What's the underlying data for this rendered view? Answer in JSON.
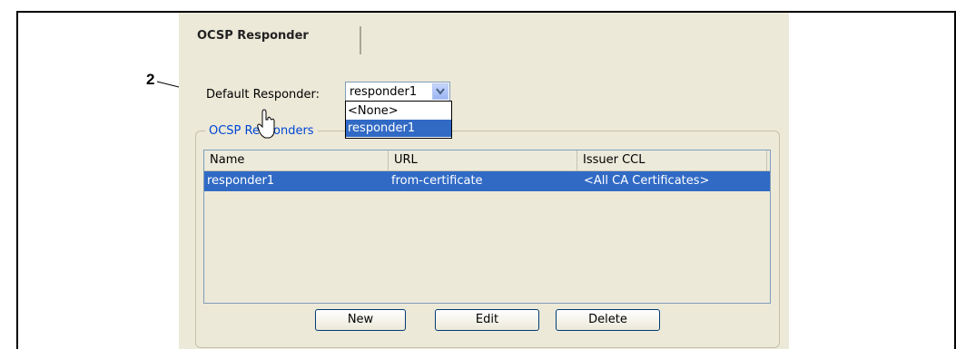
{
  "callout": {
    "number": "2"
  },
  "tab": {
    "label": "OCSP Responder"
  },
  "default_responder": {
    "label": "Default Responder:",
    "selected": "responder1",
    "options": [
      "<None>",
      "responder1"
    ]
  },
  "group": {
    "title": "OCSP Responders"
  },
  "table": {
    "columns": [
      "Name",
      "URL",
      "Issuer CCL"
    ],
    "rows": [
      {
        "name": "responder1",
        "url": "from-certificate",
        "issuer_ccl": "<All CA Certificates>"
      }
    ]
  },
  "buttons": {
    "new": "New",
    "edit": "Edit",
    "delete": "Delete"
  },
  "colors": {
    "selection": "#316ac5",
    "panel": "#ece9d8",
    "group_title": "#0046d5"
  }
}
